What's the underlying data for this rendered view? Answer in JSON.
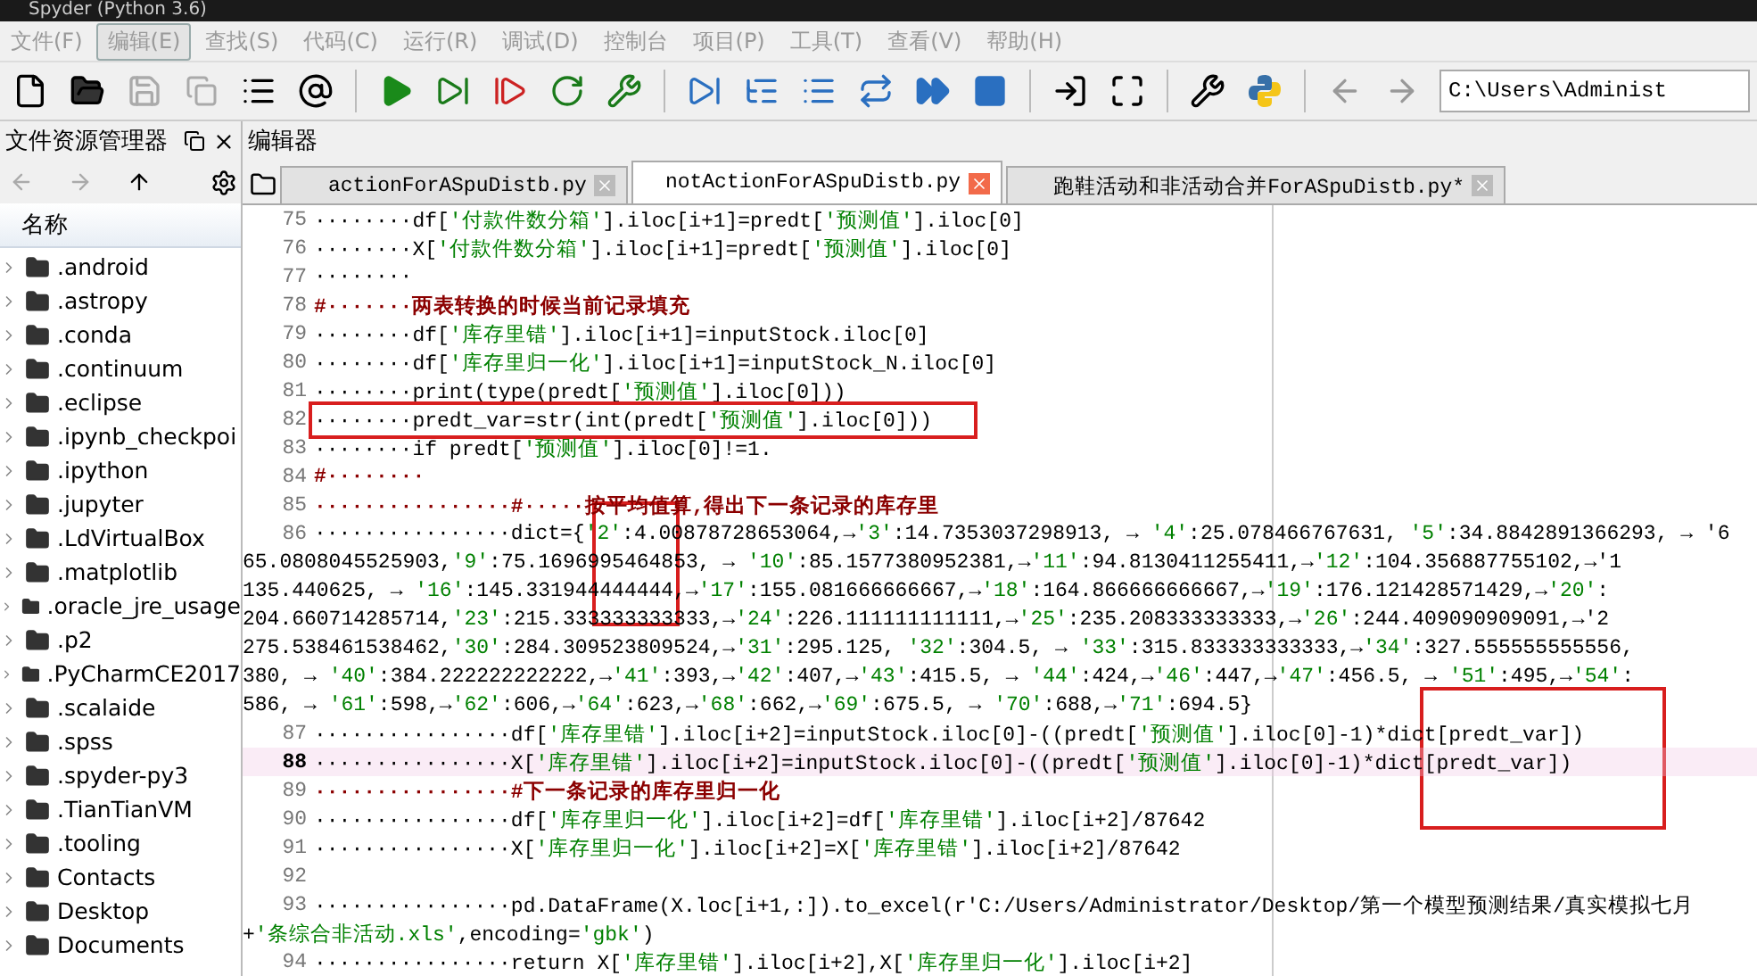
{
  "window": {
    "title": "Spyder (Python 3.6)"
  },
  "menu": [
    {
      "label": "文件(F)",
      "selected": false
    },
    {
      "label": "编辑(E)",
      "selected": true
    },
    {
      "label": "查找(S)",
      "selected": false
    },
    {
      "label": "代码(C)",
      "selected": false
    },
    {
      "label": "运行(R)",
      "selected": false
    },
    {
      "label": "调试(D)",
      "selected": false
    },
    {
      "label": "控制台",
      "selected": false
    },
    {
      "label": "项目(P)",
      "selected": false
    },
    {
      "label": "工具(T)",
      "selected": false
    },
    {
      "label": "查看(V)",
      "selected": false
    },
    {
      "label": "帮助(H)",
      "selected": false
    }
  ],
  "toolbar": {
    "path": "C:\\Users\\Administ"
  },
  "file_explorer": {
    "title": "文件资源管理器",
    "column": "名称",
    "items": [
      ".android",
      ".astropy",
      ".conda",
      ".continuum",
      ".eclipse",
      ".ipynb_checkpoi",
      ".ipython",
      ".jupyter",
      ".LdVirtualBox",
      ".matplotlib",
      ".oracle_jre_usage",
      ".p2",
      ".PyCharmCE2017",
      ".scalaide",
      ".spss",
      ".spyder-py3",
      ".TianTianVM",
      ".tooling",
      "Contacts",
      "Desktop",
      "Documents"
    ]
  },
  "editor": {
    "title": "编辑器",
    "tabs": [
      {
        "label": "actionForASpuDistb.py",
        "selected": false
      },
      {
        "label": "notActionForASpuDistb.py",
        "selected": true
      },
      {
        "label": "跑鞋活动和非活动合并ForASpuDistb.py*",
        "selected": false
      }
    ],
    "lines": [
      {
        "number": "75",
        "kind": "code",
        "current": false,
        "text": "········df['付款件数分箱'].iloc[i+1]=predt['预测值'].iloc[0]"
      },
      {
        "number": "76",
        "kind": "code",
        "current": false,
        "text": "········X['付款件数分箱'].iloc[i+1]=predt['预测值'].iloc[0]"
      },
      {
        "number": "77",
        "kind": "code",
        "current": false,
        "text": "········"
      },
      {
        "number": "78",
        "kind": "comment",
        "current": false,
        "text": "#·······两表转换的时候当前记录填充"
      },
      {
        "number": "79",
        "kind": "code",
        "current": false,
        "text": "········df['库存里错'].iloc[i+1]=inputStock.iloc[0]"
      },
      {
        "number": "80",
        "kind": "code",
        "current": false,
        "text": "········df['库存里归一化'].iloc[i+1]=inputStock_N.iloc[0]"
      },
      {
        "number": "81",
        "kind": "code",
        "current": false,
        "text": "········print(type(predt['预测值'].iloc[0]))"
      },
      {
        "number": "82",
        "kind": "code",
        "current": false,
        "boxed": true,
        "text": "········predt_var=str(int(predt['预测值'].iloc[0]))"
      },
      {
        "number": "83",
        "kind": "code",
        "current": false,
        "text": "········if predt['预测值'].iloc[0]!=1."
      },
      {
        "number": "84",
        "kind": "comment",
        "current": false,
        "text": "#········"
      },
      {
        "number": "85",
        "kind": "comment",
        "current": false,
        "text": "················#·····按平均值算,得出下一条记录的库存里"
      },
      {
        "number": "86",
        "kind": "code",
        "current": false,
        "text": "················dict={'2':4.00878728653064,→'3':14.7353037298913, → '4':25.078466767631, '5':34.8842891366293, → '6"
      },
      {
        "kind": "code",
        "current": false,
        "text": "65.0808045525903,'9':75.1696995464853, → '10':85.1577380952381,→'11':94.8130411255411,→'12':104.356887755102,→'1"
      },
      {
        "kind": "code",
        "current": false,
        "text": "135.440625, → '16':145.331944444444,→'17':155.081666666667,→'18':164.866666666667,→'19':176.121428571429,→'20':"
      },
      {
        "kind": "code",
        "current": false,
        "text": "204.660714285714,'23':215.333333333333,→'24':226.111111111111,→'25':235.208333333333,→'26':244.409090909091,→'2"
      },
      {
        "kind": "code",
        "current": false,
        "text": "275.538461538462,'30':284.309523809524,→'31':295.125, '32':304.5, → '33':315.833333333333,→'34':327.555555555556,"
      },
      {
        "kind": "code",
        "current": false,
        "text": "380, → '40':384.222222222222,→'41':393,→'42':407,→'43':415.5, → '44':424,→'46':447,→'47':456.5, → '51':495,→'54':"
      },
      {
        "kind": "code",
        "current": false,
        "text": "586, → '61':598,→'62':606,→'64':623,→'68':662,→'69':675.5, → '70':688,→'71':694.5}"
      },
      {
        "number": "87",
        "kind": "code",
        "current": false,
        "text": "················df['库存里错'].iloc[i+2]=inputStock.iloc[0]-((predt['预测值'].iloc[0]-1)*dict[predt_var])"
      },
      {
        "number": "88",
        "kind": "code",
        "current": true,
        "text": "················X['库存里错'].iloc[i+2]=inputStock.iloc[0]-((predt['预测值'].iloc[0]-1)*dict[predt_var])"
      },
      {
        "number": "89",
        "kind": "comment",
        "current": false,
        "text": "················#下一条记录的库存里归一化"
      },
      {
        "number": "90",
        "kind": "code",
        "current": false,
        "text": "················df['库存里归一化'].iloc[i+2]=df['库存里错'].iloc[i+2]/87642"
      },
      {
        "number": "91",
        "kind": "code",
        "current": false,
        "text": "················X['库存里归一化'].iloc[i+2]=X['库存里错'].iloc[i+2]/87642"
      },
      {
        "number": "92",
        "kind": "code",
        "current": false
      },
      {
        "number": "93",
        "kind": "code",
        "current": false,
        "text": "················pd.DataFrame(X.loc[i+1,:]).to_excel(r'C:/Users/Administrator/Desktop/第一个模型预测结果/真实模拟七月"
      },
      {
        "kind": "code",
        "current": false,
        "text": "+'条综合非活动.xls',encoding='gbk')"
      },
      {
        "number": "94",
        "kind": "code",
        "current": false,
        "text": "················return X['库存里错'].iloc[i+2],X['库存里归一化'].iloc[i+2]"
      }
    ]
  }
}
